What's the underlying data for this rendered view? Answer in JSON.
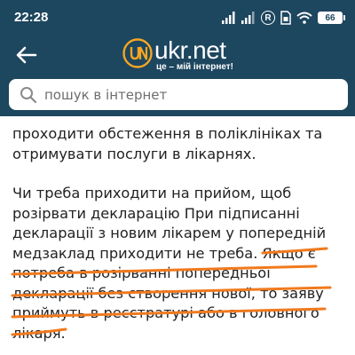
{
  "status_bar": {
    "time": "22:28",
    "battery": "66"
  },
  "header": {
    "logo_name": "ukr.net",
    "slogan": "це – мій інтернет!",
    "background": "#1d465f"
  },
  "search": {
    "placeholder": "пошук в інтернет"
  },
  "article": {
    "paragraph1": [
      "проходити обстеження в поліклініках та",
      "отримувати послуги в лікарнях."
    ],
    "paragraph2": [
      "Чи треба приходити на прийом, щоб",
      "розірвати декларацію При підписанні",
      "декларації з новим лікарем у попередній",
      "медзаклад приходити не треба. Якщо є",
      "потреба в розірванні попередньої",
      "декларації без створення нової, то заяву",
      "приймуть в реєстратурі або в головного",
      "лікаря."
    ]
  },
  "annotation_color": "#f07a1e"
}
